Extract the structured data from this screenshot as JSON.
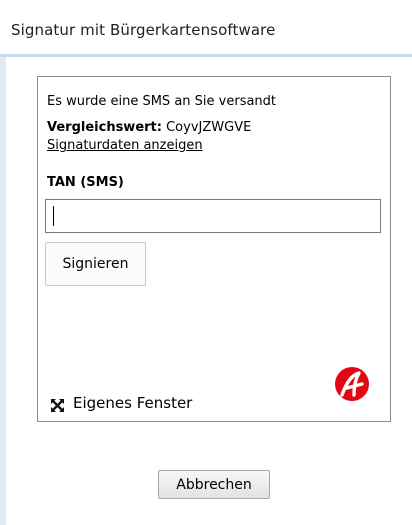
{
  "dialog": {
    "title": "Signatur mit Bürgerkartensoftware"
  },
  "signature": {
    "sms_sent_message": "Es wurde eine SMS an Sie versandt",
    "compare_label": "Vergleichswert:",
    "compare_value": "CoyvJZWGVE",
    "show_data_link": "Signaturdaten anzeigen",
    "tan_label": "TAN (SMS)",
    "tan_value": "",
    "sign_button": "Signieren",
    "own_window_label": "Eigenes Fenster",
    "own_window_icon": "expand-icon"
  },
  "brand": {
    "logo_icon": "a-trust-logo",
    "logo_color": "#e30613"
  },
  "footer": {
    "cancel_button": "Abbrechen"
  }
}
